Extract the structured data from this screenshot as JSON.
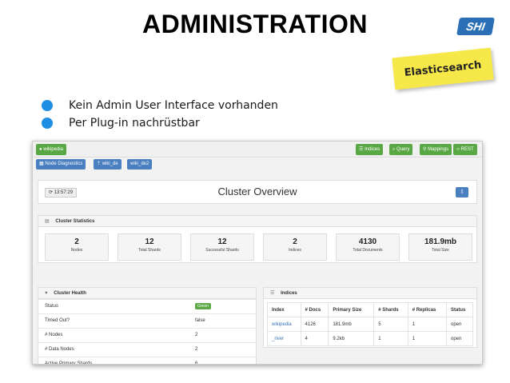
{
  "slide": {
    "title": "ADMINISTRATION",
    "logo_text": "SHI",
    "sticky_note": "Elasticsearch",
    "bullets": [
      "Kein Admin User Interface vorhanden",
      "Per Plug-in nachrüstbar"
    ],
    "bullet_color": "#1f8fe6"
  },
  "app": {
    "cluster_button": "wikipedia",
    "nav": [
      "Indices",
      "Query",
      "Mappings",
      "REST"
    ],
    "sub_nav": [
      "Node Diagnostics",
      "wiki_de",
      "wiki_de2"
    ],
    "refresh_time": "13:57:29",
    "overview_title": "Cluster Overview",
    "stats_title": "Cluster Statistics",
    "stats": [
      {
        "value": "2",
        "label": "Nodes"
      },
      {
        "value": "12",
        "label": "Total Shards"
      },
      {
        "value": "12",
        "label": "Successful Shards"
      },
      {
        "value": "2",
        "label": "Indices"
      },
      {
        "value": "4130",
        "label": "Total Documents"
      },
      {
        "value": "181.9mb",
        "label": "Total Size"
      }
    ],
    "health_title": "Cluster Health",
    "health_rows": [
      {
        "key": "Status",
        "value": "Green"
      },
      {
        "key": "Timed Out?",
        "value": "false"
      },
      {
        "key": "# Nodes",
        "value": "2"
      },
      {
        "key": "# Data Nodes",
        "value": "2"
      },
      {
        "key": "Active Primary Shards",
        "value": "6"
      }
    ],
    "indices_title": "Indices",
    "indices_columns": [
      "Index",
      "# Docs",
      "Primary Size",
      "# Shards",
      "# Replicas",
      "Status"
    ],
    "indices_rows": [
      [
        "wikipedia",
        "4126",
        "181.9mb",
        "5",
        "1",
        "open"
      ],
      [
        "_river",
        "4",
        "9.2kb",
        "1",
        "1",
        "open"
      ]
    ],
    "colors": {
      "green": "#5aa845",
      "blue": "#4a7fc0",
      "link": "#3b73b9"
    }
  }
}
